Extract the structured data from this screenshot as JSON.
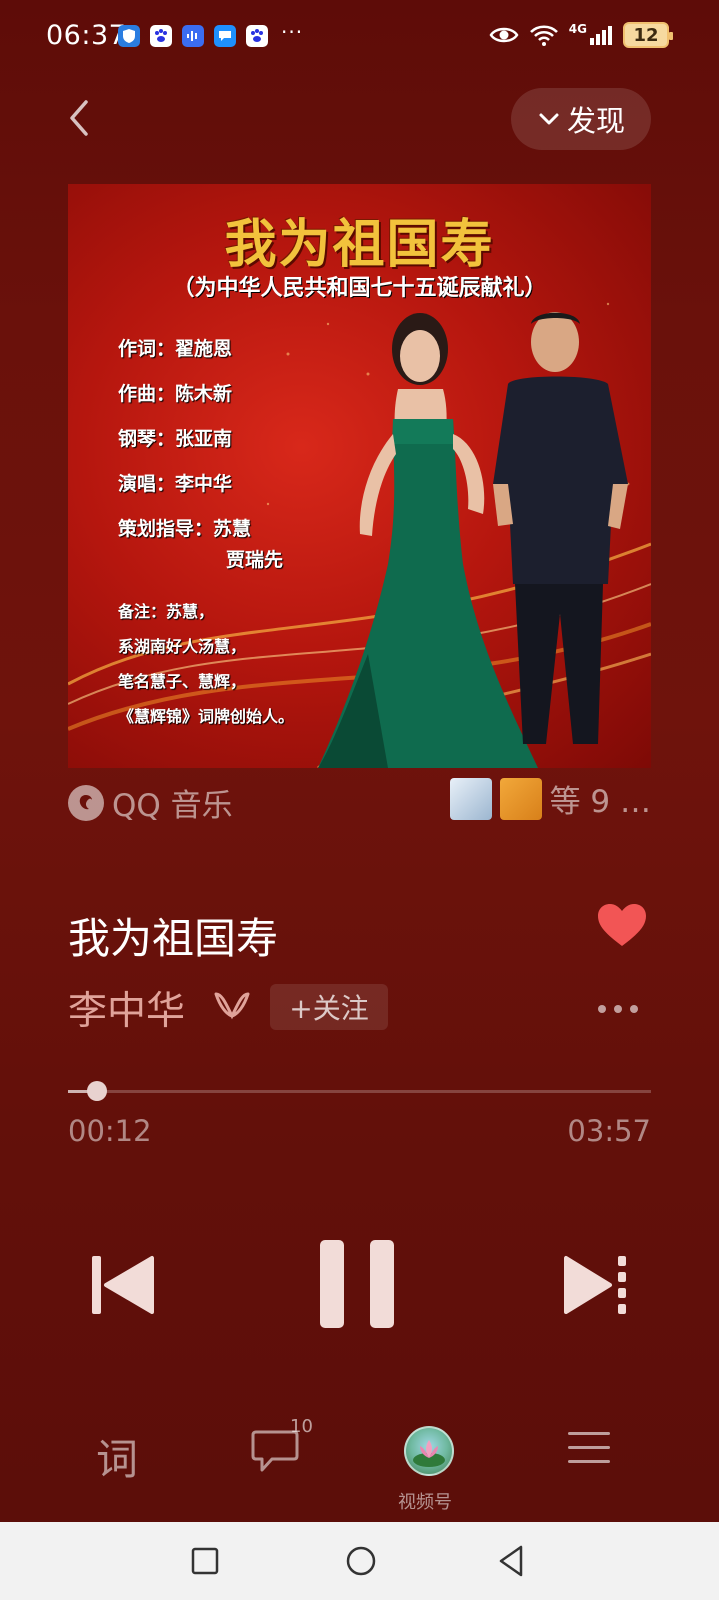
{
  "status_bar": {
    "time": "06:37",
    "more": "···",
    "network": "4G",
    "battery": "12"
  },
  "header": {
    "discover_label": "发现"
  },
  "album": {
    "title": "我为祖国寿",
    "subtitle": "（为中华人民共和国七十五诞辰献礼）",
    "credits": [
      "作词：翟施恩",
      "作曲：陈木新",
      "钢琴：张亚南",
      "演唱：李中华",
      "策划指导：苏慧",
      "贾瑞先"
    ],
    "notes": [
      "备注：苏慧，",
      "系湖南好人汤慧，",
      "笔名慧子、慧辉，",
      "《慧辉锦》词牌创始人。"
    ]
  },
  "source": {
    "label": "QQ 音乐",
    "listeners": "等 9 …"
  },
  "song": {
    "title": "我为祖国寿",
    "artist": "李中华",
    "follow_label": "+关注",
    "liked": true
  },
  "progress": {
    "current": "00:12",
    "total": "03:57",
    "fraction": 0.05
  },
  "bottom_tabs": {
    "lyrics": "词",
    "comments_count": "10",
    "channels": "视频号"
  },
  "colors": {
    "accent_heart": "#f25555",
    "title_gold": "#f2c23c"
  }
}
